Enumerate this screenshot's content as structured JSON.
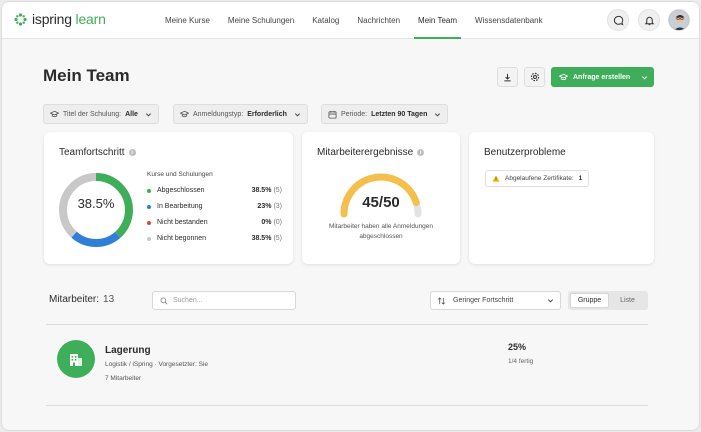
{
  "brand": {
    "name_prefix": "ispring",
    "name_suffix": "learn",
    "color": "#3fae5a"
  },
  "nav": {
    "items": [
      {
        "label": "Meine Kurse"
      },
      {
        "label": "Meine Schulungen"
      },
      {
        "label": "Katalog"
      },
      {
        "label": "Nachrichten"
      },
      {
        "label": "Mein Team"
      },
      {
        "label": "Wissensdatenbank"
      }
    ],
    "active": "Mein Team",
    "icons": [
      "chat-icon",
      "bell-icon",
      "avatar"
    ]
  },
  "header": {
    "title": "Mein Team",
    "icons": [
      "download-icon",
      "gear-icon"
    ],
    "primary_button": "Anfrage erstellen"
  },
  "filters": [
    {
      "label": "Titel der Schulung:",
      "value": "Alle",
      "icon": "graduation-cap-icon"
    },
    {
      "label": "Anmeldungstyp:",
      "value": "Erforderlich",
      "icon": "graduation-cap-icon"
    },
    {
      "label": "Periode:",
      "value": "Letzten 90 Tagen",
      "icon": "calendar-icon"
    }
  ],
  "team_progress": {
    "title": "Teamfortschritt",
    "center_value": "38.5%",
    "legend_title": "Kurse und Schulungen",
    "rows": [
      {
        "label": "Abgeschlossen",
        "pct": "38.5%",
        "count": "(5)",
        "color": "#3fae5a",
        "fraction": 0.385
      },
      {
        "label": "In Bearbeitung",
        "pct": "23%",
        "count": "(3)",
        "color": "#2f7fd9",
        "fraction": 0.23
      },
      {
        "label": "Nicht bestanden",
        "pct": "0%",
        "count": "(0)",
        "color": "#e0463a",
        "fraction": 0
      },
      {
        "label": "Nicht begonnen",
        "pct": "38.5%",
        "count": "(5)",
        "color": "#c8c8c8",
        "fraction": 0.385
      }
    ]
  },
  "employee_results": {
    "title": "Mitarbeiterergebnisse",
    "value": "45/50",
    "fraction": 0.9,
    "gauge_color": "#f4c04b",
    "caption_line1": "Mitarbeiter haben alle Anmeldungen",
    "caption_line2": "abgeschlossen"
  },
  "user_problems": {
    "title": "Benutzerprobleme",
    "badge_label": "Abgelaufene Zertifikate:",
    "badge_count": "1"
  },
  "members": {
    "label": "Mitarbeiter:",
    "count": "13",
    "search_placeholder": "Suchen...",
    "sort_value": "Geringer Fortschritt",
    "view_options": [
      "Gruppe",
      "Liste"
    ],
    "view_selected": "Gruppe"
  },
  "group": {
    "name": "Lagerung",
    "meta": "Logistik / iSpring · Vorgesetzter: Sie",
    "members": "7 Mitarbeiter",
    "pct": "25%",
    "done": "1/4 fertig"
  }
}
